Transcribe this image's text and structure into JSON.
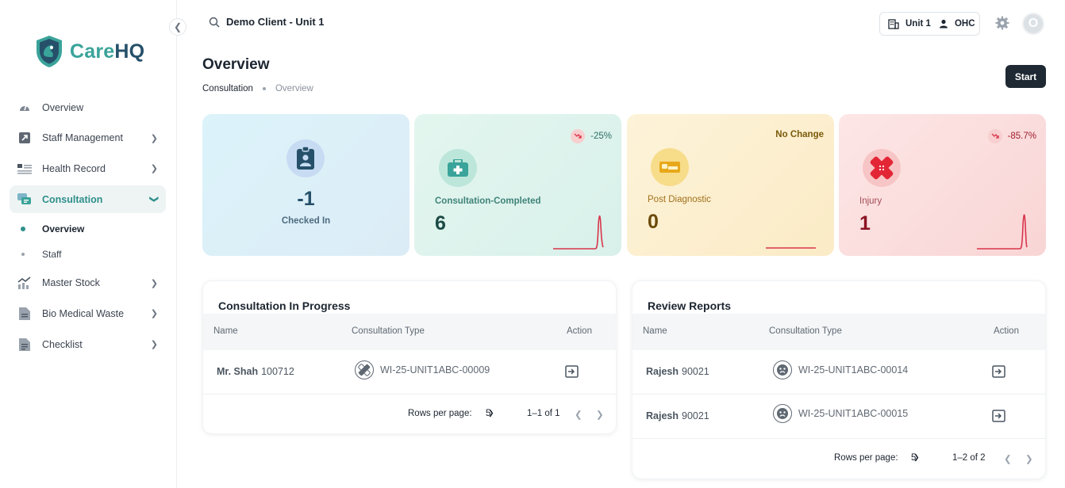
{
  "brand": {
    "name_a": "Care",
    "name_b": "HQ",
    "color_primary": "#3aa39a",
    "color_dark": "#26506a"
  },
  "sidebar": {
    "items": [
      {
        "label": "Overview",
        "icon": "gauge-icon",
        "chevron": false
      },
      {
        "label": "Staff Management",
        "icon": "staff-icon",
        "chevron": true
      },
      {
        "label": "Health Record",
        "icon": "record-icon",
        "chevron": true
      },
      {
        "label": "Consultation",
        "icon": "chat-icon",
        "chevron": true,
        "expanded": true
      },
      {
        "label": "Master Stock",
        "icon": "chart-icon",
        "chevron": true
      },
      {
        "label": "Bio Medical Waste",
        "icon": "document-icon",
        "chevron": true
      },
      {
        "label": "Checklist",
        "icon": "checklist-icon",
        "chevron": true
      }
    ],
    "sub_items": [
      {
        "label": "Overview",
        "active": true
      },
      {
        "label": "Staff",
        "active": false
      }
    ]
  },
  "topbar": {
    "client": "Demo Client - Unit 1",
    "unit": "Unit 1",
    "role": "OHC",
    "avatar_initial": "O"
  },
  "header": {
    "title": "Overview",
    "breadcrumb": [
      "Consultation",
      "Overview"
    ],
    "start_label": "Start"
  },
  "cards": [
    {
      "label": "Checked In",
      "value": "-1",
      "trend": ""
    },
    {
      "label": "Consultation-Completed",
      "value": "6",
      "trend": "-25%"
    },
    {
      "label": "Post Diagnostic",
      "value": "0",
      "trend": "No Change"
    },
    {
      "label": "Injury",
      "value": "1",
      "trend": "-85.7%"
    }
  ],
  "in_progress": {
    "title": "Consultation In Progress",
    "columns": [
      "Name",
      "Consultation Type",
      "Action"
    ],
    "rows": [
      {
        "name": "Mr. Shah",
        "id": "100712",
        "type": "WI-25-UNIT1ABC-00009"
      }
    ],
    "rows_per_page_label": "Rows per page:",
    "rows_per_page": "5",
    "range": "1–1 of 1"
  },
  "review": {
    "title": "Review Reports",
    "columns": [
      "Name",
      "Consultation Type",
      "Action"
    ],
    "rows": [
      {
        "name": "Rajesh",
        "id": "90021",
        "type": "WI-25-UNIT1ABC-00014"
      },
      {
        "name": "Rajesh",
        "id": "90021",
        "type": "WI-25-UNIT1ABC-00015"
      }
    ],
    "rows_per_page_label": "Rows per page:",
    "rows_per_page": "5",
    "range": "1–2 of 2"
  }
}
